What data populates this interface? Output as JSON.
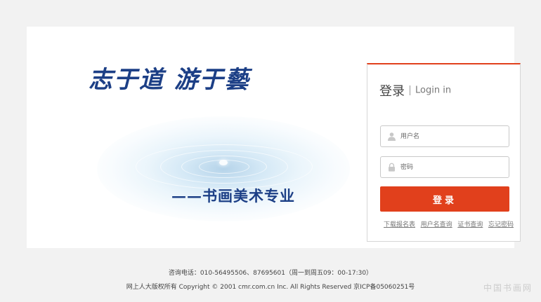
{
  "hero": {
    "slogan_main": "志于道  游于藝",
    "slogan_sub": "——书画美术专业"
  },
  "login": {
    "title": "登录",
    "subtitle": "Login in",
    "username_placeholder": "用户名",
    "username_icon": "user-icon",
    "password_placeholder": "密码",
    "password_icon": "lock-icon",
    "submit_label": "登录",
    "links": [
      "下载报名表",
      "用户名查询",
      "证书查询",
      "忘记密码"
    ]
  },
  "footer": {
    "contact": "咨询电话：010-56495506、87695601（周一到周五09：00-17:30）",
    "copyright": "网上人大版权所有 Copyright © 2001 cmr.com.cn Inc. All Rights Reserved 京ICP备05060251号"
  },
  "watermark": "中国书画网",
  "colors": {
    "accent": "#e1401c",
    "brand_text": "#1c3f86",
    "page_background": "#f2f2f2"
  }
}
